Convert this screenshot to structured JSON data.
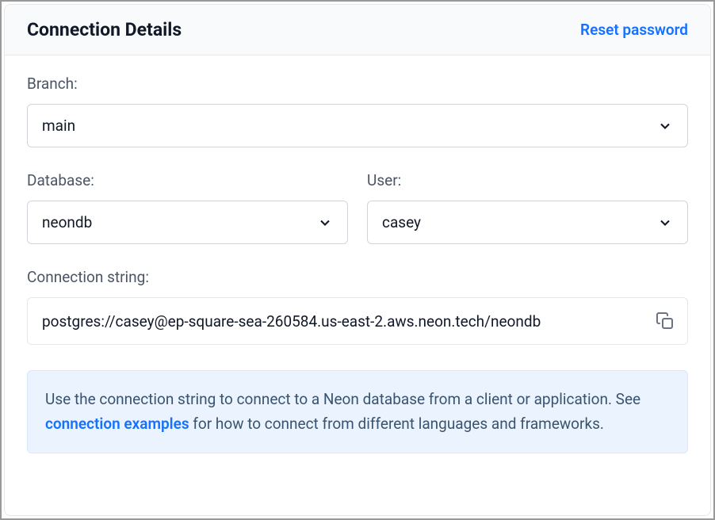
{
  "header": {
    "title": "Connection Details",
    "resetLink": "Reset password"
  },
  "fields": {
    "branch": {
      "label": "Branch:",
      "value": "main"
    },
    "database": {
      "label": "Database:",
      "value": "neondb"
    },
    "user": {
      "label": "User:",
      "value": "casey"
    },
    "connectionString": {
      "label": "Connection string:",
      "value": "postgres://casey@ep-square-sea-260584.us-east-2.aws.neon.tech/neondb"
    }
  },
  "info": {
    "textBefore": "Use the connection string to connect to a Neon database from a client or application. See ",
    "linkText": "connection examples",
    "textAfter": " for how to connect from different languages and frameworks."
  }
}
